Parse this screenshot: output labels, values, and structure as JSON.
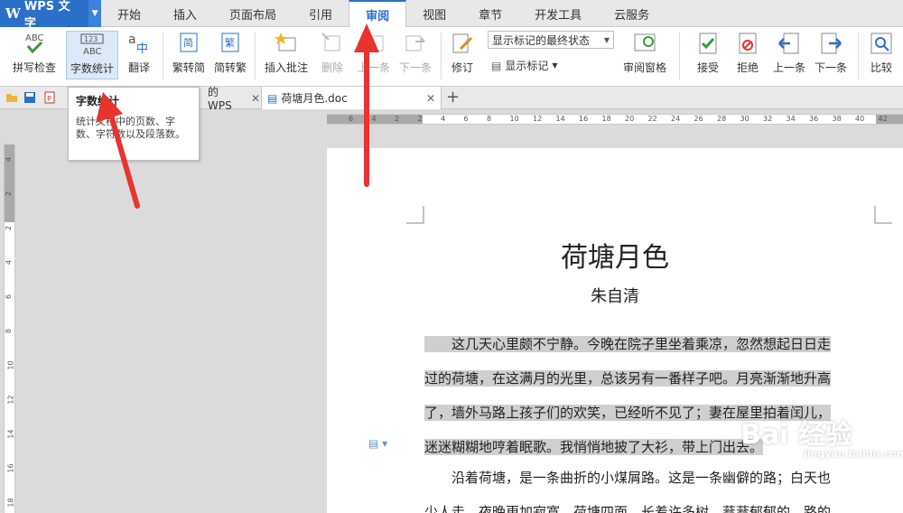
{
  "app": {
    "name": "WPS 文字",
    "logo_glyph": "W"
  },
  "menu_tabs": [
    "开始",
    "插入",
    "页面布局",
    "引用",
    "审阅",
    "视图",
    "章节",
    "开发工具",
    "云服务"
  ],
  "active_tab": "审阅",
  "ribbon": {
    "spell_check": "拼写检查",
    "word_count": "字数统计",
    "translate": "翻译",
    "to_traditional": "繁转简",
    "to_simplified": "简转繁",
    "insert_comment": "插入批注",
    "delete": "删除",
    "prev_item": "上一条",
    "next_item": "下一条",
    "track_changes": "修订",
    "markup_select": "显示标记的最终状态",
    "show_markup": "显示标记",
    "review_pane": "审阅窗格",
    "accept": "接受",
    "reject": "拒绝",
    "prev_change": "上一条",
    "next_change": "下一条",
    "compare": "比较"
  },
  "tooltip": {
    "title": "字数统计",
    "description": "统计文档中的页数、字数、字符数以及段落数。"
  },
  "doc_tabs": [
    {
      "label": "的WPS"
    },
    {
      "label": "荷塘月色.doc",
      "active": true
    }
  ],
  "ruler": {
    "h_ticks": [
      "6",
      "4",
      "2",
      "2",
      "4",
      "6",
      "8",
      "10",
      "12",
      "14",
      "16",
      "18",
      "20",
      "22",
      "24",
      "26",
      "28",
      "30",
      "32",
      "34",
      "36",
      "38",
      "40",
      "42"
    ],
    "v_ticks": [
      "4",
      "2",
      "2",
      "4",
      "6",
      "8",
      "10",
      "12",
      "14",
      "16",
      "18"
    ]
  },
  "document": {
    "title": "荷塘月色",
    "author": "朱自清",
    "para1_lines": [
      "　　这几天心里颇不宁静。今晚在院子里坐着乘凉，忽然想起日日走",
      "过的荷塘，在这满月的光里，总该另有一番样子吧。月亮渐渐地升高",
      "了，墙外马路上孩子们的欢笑，已经听不见了；妻在屋里拍着闰儿，",
      "迷迷糊糊地哼着眠歌。我悄悄地披了大衫，带上门出去。"
    ],
    "para2_lines": [
      "　　沿着荷塘，是一条曲折的小煤屑路。这是一条幽僻的路；白天也",
      "少人走，夜晚更加寂寞。荷塘四面，长着许多树，蓊蓊郁郁的。路的"
    ]
  },
  "colors": {
    "accent": "#2b6fc9",
    "arrow": "#e8332e",
    "selection": "#cfcfcf"
  },
  "watermark": {
    "text": "Bai 经验",
    "sub": "jingyan.baidu.com"
  }
}
